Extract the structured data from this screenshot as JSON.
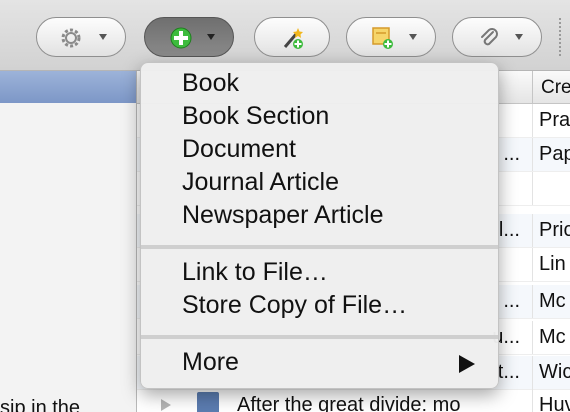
{
  "toolbar": {
    "buttons": [
      {
        "name": "actions",
        "icon": "gear-icon"
      },
      {
        "name": "new-item",
        "icon": "plus-circle-icon"
      },
      {
        "name": "add-by-identifier",
        "icon": "magic-wand-icon"
      },
      {
        "name": "new-note",
        "icon": "note-icon"
      },
      {
        "name": "add-attachment",
        "icon": "paperclip-icon"
      }
    ]
  },
  "items": {
    "column_creator_header": "Cre",
    "rows": [
      {
        "title_tail": "",
        "creator": "Pra"
      },
      {
        "title_tail": "...",
        "creator": "Pap"
      },
      {
        "title_tail": "",
        "creator": ""
      },
      {
        "title_tail": "l...",
        "creator": "Pric"
      },
      {
        "title_tail": "",
        "creator": "Lin"
      },
      {
        "title_tail": "...",
        "creator": "Mc"
      },
      {
        "title_tail": "u...",
        "creator": "Mc"
      },
      {
        "title_tail": "t...",
        "creator": "Wic"
      },
      {
        "title_tail": "After the great divide: mo",
        "creator": "Huv"
      }
    ]
  },
  "left_pane": {
    "bottom_text": "sip in the"
  },
  "menu": {
    "item_types": [
      "Book",
      "Book Section",
      "Document",
      "Journal Article",
      "Newspaper Article"
    ],
    "file_items": [
      "Link to File…",
      "Store Copy of File…"
    ],
    "more": "More"
  },
  "colors": {
    "selection": "#7d97c7",
    "new_item_icon": "#3dbb3d"
  }
}
